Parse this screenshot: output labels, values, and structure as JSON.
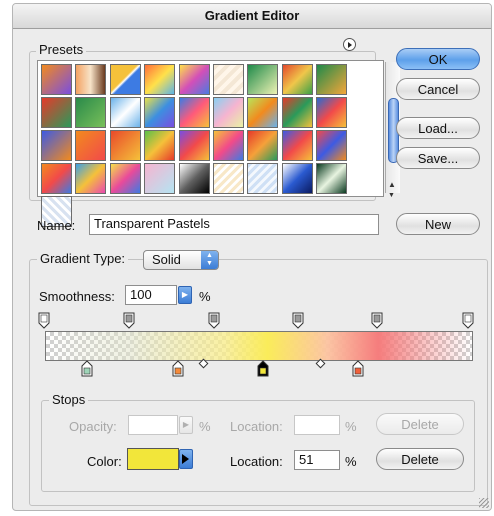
{
  "window": {
    "title": "Gradient Editor"
  },
  "presets": {
    "label": "Presets",
    "swatches": [
      "linear-gradient(135deg,#f28a1e 0%,#7a4ee0 100%)",
      "linear-gradient(90deg,#f4a262,#f7e3c8,#6b3b1f)",
      "linear-gradient(135deg,#f5c13a 45%,#ffffff 50%,#3d7be3 55%)",
      "linear-gradient(135deg,#ff6f3a,#ffe14a,#5bb4e6)",
      "linear-gradient(135deg,#ffe04a,#d34fb8,#4a7be0)",
      "repeating-linear-gradient(135deg,#f4e7d5 0 4px,#fff6ea 4px 8px)",
      "linear-gradient(135deg,#1f8a4a,#eef2b4)",
      "linear-gradient(135deg,#e3492d,#f0c64a,#3aa047)",
      "linear-gradient(135deg,#1f8a4a,#f4a63a)",
      "linear-gradient(135deg,#e63a2a,#2a9a5a)",
      "linear-gradient(135deg,#2a8a4a,#79c05a)",
      "linear-gradient(135deg,#6ab2ea,#ffffff 50%,#6ab2ea)",
      "linear-gradient(135deg,#e9e04a,#3d8fe0,#7a4ee0)",
      "linear-gradient(135deg,#3d7be3,#ff5a7a,#f5c13a)",
      "linear-gradient(135deg,#8ad0f2,#f6b4d0,#e9f2a4)",
      "linear-gradient(135deg,#b8e45a,#f28a1e,#6ab2ea)",
      "linear-gradient(135deg,#e63a2a,#2a9a5a,#f5c13a)",
      "linear-gradient(135deg,#2a6ad0,#f24a4a,#f5c13a)",
      "linear-gradient(135deg,#3d5be3,#f28a1e)",
      "linear-gradient(135deg,#f28a1e,#f24a4a)",
      "linear-gradient(135deg,#e94a2a,#f5c13a)",
      "linear-gradient(135deg,#5bc04a,#f5c13a,#e63a2a)",
      "linear-gradient(135deg,#7a4ee0,#f24a4a,#f5c13a)",
      "linear-gradient(135deg,#f5c13a,#f24a8a,#3d7be3)",
      "linear-gradient(135deg,#e63a2a,#f5a13a,#2a9a5a)",
      "linear-gradient(135deg,#3d5be3,#f24a4a,#f5c13a)",
      "linear-gradient(135deg,#f24a4a,#3d5be3,#f28a1e)",
      "linear-gradient(135deg,#f28a1e,#f24a4a,#3d7be3)",
      "linear-gradient(135deg,#3da0e3,#f5c13a,#e94ab0)",
      "linear-gradient(135deg,#f5e04a,#e94a9a,#3d7be3)",
      "linear-gradient(135deg,#f6b4d0,#b4e4f2)",
      "linear-gradient(135deg,#ffffff,#606060,#000000)",
      "repeating-linear-gradient(135deg,#f8e8c8 0 3px,#ffffff 3px 6px)",
      "repeating-linear-gradient(135deg,#cfe0f5 0 3px,#f4f8fd 3px 6px)",
      "linear-gradient(135deg,#ffffff,#2a5ad0,#0a1a60)",
      "linear-gradient(135deg,#0a3a20,#e8f4e0 50%,#0a3a20)",
      "repeating-linear-gradient(45deg,#d8e2f0 0 3px,#ffffff 3px 6px)"
    ],
    "menu_icon": "flyout-menu-icon"
  },
  "buttons": {
    "ok": "OK",
    "cancel": "Cancel",
    "load": "Load...",
    "save": "Save...",
    "new": "New"
  },
  "name": {
    "label": "Name:",
    "value": "Transparent Pastels"
  },
  "gradient_type": {
    "label": "Gradient Type:",
    "value": "Solid",
    "smoothness_label": "Smoothness:",
    "smoothness_value": "100",
    "percent": "%"
  },
  "stops": {
    "label": "Stops",
    "opacity_label": "Opacity:",
    "opacity_value": "",
    "opacity_unit": "%",
    "location_label": "Location:",
    "opacity_location_value": "",
    "location_unit": "%",
    "delete_label": "Delete",
    "color_label": "Color:",
    "color_value": "#f2e63a",
    "color_location_value": "51",
    "opacity_stop_colors": [
      "#ffffff",
      "#9a9a9a",
      "#9a9a9a",
      "#9a9a9a",
      "#9a9a9a",
      "#ffffff"
    ],
    "color_stop_colors": [
      "#9fd4b8",
      "#f58a3a",
      "#f2e63a",
      "#f0603a"
    ]
  }
}
